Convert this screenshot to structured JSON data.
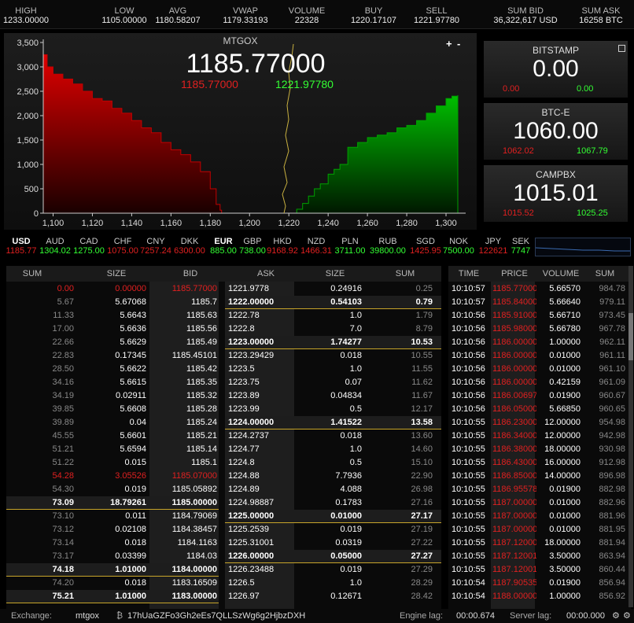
{
  "stats": [
    {
      "k": "HIGH",
      "v": "1233.00000"
    },
    {
      "k": "LOW",
      "v": "1105.00000"
    },
    {
      "k": "AVG",
      "v": "1180.58207"
    },
    {
      "k": "VWAP",
      "v": "1179.33193"
    },
    {
      "k": "VOLUME",
      "v": "22328"
    },
    {
      "k": "BUY",
      "v": "1220.17107"
    },
    {
      "k": "SELL",
      "v": "1221.97780"
    },
    {
      "k": "SUM BID",
      "v": "36,322,617 USD"
    },
    {
      "k": "SUM ASK",
      "v": "16258 BTC"
    }
  ],
  "chart": {
    "title": "MTGOX",
    "last": "1185.77000",
    "bid": "1185.77000",
    "ask": "1221.97780",
    "zoom_in": "+",
    "zoom_out": "-",
    "yticks": [
      "3,500",
      "3,000",
      "2,500",
      "2,000",
      "1,500",
      "1,000",
      "500",
      "0"
    ],
    "xticks": [
      "1,100",
      "1,120",
      "1,140",
      "1,160",
      "1,180",
      "1,200",
      "1,220",
      "1,240",
      "1,260",
      "1,280",
      "1,300"
    ]
  },
  "chart_data": {
    "type": "area",
    "xlim": [
      1095,
      1310
    ],
    "ylim": [
      0,
      3500
    ],
    "series": [
      {
        "color": "#c00000",
        "x": [
          1095,
          1097,
          1100,
          1105,
          1110,
          1115,
          1120,
          1125,
          1130,
          1135,
          1140,
          1145,
          1150,
          1155,
          1160,
          1165,
          1170,
          1175,
          1180,
          1183,
          1185,
          1185.77
        ],
        "y": [
          3250,
          3000,
          2850,
          2750,
          2650,
          2500,
          2350,
          2300,
          2150,
          2050,
          1900,
          1750,
          1650,
          1450,
          1300,
          1200,
          1050,
          850,
          500,
          180,
          60,
          0
        ]
      },
      {
        "color": "#00a000",
        "x": [
          1221.98,
          1224,
          1227,
          1230,
          1233,
          1236,
          1240,
          1243,
          1246,
          1250,
          1255,
          1260,
          1265,
          1270,
          1275,
          1280,
          1285,
          1290,
          1295,
          1300,
          1303,
          1306
        ],
        "y": [
          0,
          80,
          200,
          350,
          500,
          600,
          800,
          900,
          1000,
          1350,
          1450,
          1550,
          1600,
          1650,
          1750,
          1800,
          1900,
          2050,
          2200,
          2350,
          2400,
          2420
        ]
      }
    ]
  },
  "exchanges": [
    {
      "name": "BITSTAMP",
      "price": "0.00",
      "low": "0.00",
      "high": "0.00"
    },
    {
      "name": "BTC-E",
      "price": "1060.00",
      "low": "1062.02",
      "high": "1067.79"
    },
    {
      "name": "CAMPBX",
      "price": "1015.01",
      "low": "1015.52",
      "high": "1025.25"
    }
  ],
  "fiat": [
    {
      "k": "USD",
      "v": "1185.77",
      "c": "#e02020"
    },
    {
      "k": "AUD",
      "v": "1304.02",
      "c": "#33ff33"
    },
    {
      "k": "CAD",
      "v": "1275.00",
      "c": "#33ff33"
    },
    {
      "k": "CHF",
      "v": "1075.00",
      "c": "#e02020"
    },
    {
      "k": "CNY",
      "v": "7257.24",
      "c": "#e02020"
    },
    {
      "k": "DKK",
      "v": "6300.00",
      "c": "#e02020"
    },
    {
      "k": "EUR",
      "v": "885.00",
      "c": "#33ff33"
    },
    {
      "k": "GBP",
      "v": "738.00",
      "c": "#33ff33"
    },
    {
      "k": "HKD",
      "v": "9168.92",
      "c": "#e02020"
    },
    {
      "k": "NZD",
      "v": "1466.31",
      "c": "#e02020"
    },
    {
      "k": "PLN",
      "v": "3711.00",
      "c": "#33ff33"
    },
    {
      "k": "RUB",
      "v": "39800.00",
      "c": "#33ff33"
    },
    {
      "k": "SGD",
      "v": "1425.95",
      "c": "#e02020"
    },
    {
      "k": "NOK",
      "v": "7500.00",
      "c": "#33ff33"
    },
    {
      "k": "JPY",
      "v": "122621",
      "c": "#e02020"
    },
    {
      "k": "SEK",
      "v": "7747",
      "c": "#33ff33"
    }
  ],
  "book": {
    "headers": [
      "SUM",
      "SIZE",
      "BID",
      "ASK",
      "SIZE",
      "SUM"
    ],
    "rows": [
      [
        "0.00",
        "0.00000",
        "1185.77000",
        "1221.9778",
        "0.24916",
        "0.25",
        "red",
        "0",
        "0"
      ],
      [
        "5.67",
        "5.67068",
        "1185.7",
        "1222.00000",
        "0.54103",
        "0.79",
        "",
        "0",
        "1"
      ],
      [
        "11.33",
        "5.6643",
        "1185.63",
        "1222.78",
        "1.0",
        "1.79",
        "",
        "0",
        "0"
      ],
      [
        "17.00",
        "5.6636",
        "1185.56",
        "1222.8",
        "7.0",
        "8.79",
        "",
        "0",
        "0"
      ],
      [
        "22.66",
        "5.6629",
        "1185.49",
        "1223.00000",
        "1.74277",
        "10.53",
        "",
        "0",
        "1"
      ],
      [
        "22.83",
        "0.17345",
        "1185.45101",
        "1223.29429",
        "0.018",
        "10.55",
        "",
        "0",
        "0"
      ],
      [
        "28.50",
        "5.6622",
        "1185.42",
        "1223.5",
        "1.0",
        "11.55",
        "",
        "0",
        "0"
      ],
      [
        "34.16",
        "5.6615",
        "1185.35",
        "1223.75",
        "0.07",
        "11.62",
        "",
        "0",
        "0"
      ],
      [
        "34.19",
        "0.02911",
        "1185.32",
        "1223.89",
        "0.04834",
        "11.67",
        "",
        "0",
        "0"
      ],
      [
        "39.85",
        "5.6608",
        "1185.28",
        "1223.99",
        "0.5",
        "12.17",
        "",
        "0",
        "0"
      ],
      [
        "39.89",
        "0.04",
        "1185.24",
        "1224.00000",
        "1.41522",
        "13.58",
        "",
        "0",
        "1"
      ],
      [
        "45.55",
        "5.6601",
        "1185.21",
        "1224.2737",
        "0.018",
        "13.60",
        "",
        "0",
        "0"
      ],
      [
        "51.21",
        "5.6594",
        "1185.14",
        "1224.77",
        "1.0",
        "14.60",
        "",
        "0",
        "0"
      ],
      [
        "51.22",
        "0.015",
        "1185.1",
        "1224.8",
        "0.5",
        "15.10",
        "",
        "0",
        "0"
      ],
      [
        "54.28",
        "3.05526",
        "1185.07000",
        "1224.88",
        "7.7936",
        "22.90",
        "red",
        "0",
        "0"
      ],
      [
        "54.30",
        "0.019",
        "1185.05892",
        "1224.89",
        "4.088",
        "26.98",
        "",
        "0",
        "0"
      ],
      [
        "73.09",
        "18.79261",
        "1185.00000",
        "1224.98887",
        "0.1783",
        "27.16",
        "",
        "1",
        "0"
      ],
      [
        "73.10",
        "0.011",
        "1184.79069",
        "1225.00000",
        "0.01000",
        "27.17",
        "",
        "0",
        "1"
      ],
      [
        "73.12",
        "0.02108",
        "1184.38457",
        "1225.2539",
        "0.019",
        "27.19",
        "",
        "0",
        "0"
      ],
      [
        "73.14",
        "0.018",
        "1184.1163",
        "1225.31001",
        "0.0319",
        "27.22",
        "",
        "0",
        "0"
      ],
      [
        "73.17",
        "0.03399",
        "1184.03",
        "1226.00000",
        "0.05000",
        "27.27",
        "",
        "0",
        "1"
      ],
      [
        "74.18",
        "1.01000",
        "1184.00000",
        "1226.23488",
        "0.019",
        "27.29",
        "",
        "1",
        "0"
      ],
      [
        "74.20",
        "0.018",
        "1183.16509",
        "1226.5",
        "1.0",
        "28.29",
        "",
        "0",
        "0"
      ],
      [
        "75.21",
        "1.01000",
        "1183.00000",
        "1226.97",
        "0.12671",
        "28.42",
        "",
        "1",
        "0"
      ]
    ]
  },
  "trades": {
    "headers": [
      "TIME",
      "PRICE",
      "VOLUME",
      "SUM"
    ],
    "rows": [
      [
        "10:10:57",
        "1185.77000",
        "5.66570",
        "984.78"
      ],
      [
        "10:10:57",
        "1185.84000",
        "5.66640",
        "979.11"
      ],
      [
        "10:10:56",
        "1185.91000",
        "5.66710",
        "973.45"
      ],
      [
        "10:10:56",
        "1185.98000",
        "5.66780",
        "967.78"
      ],
      [
        "10:10:56",
        "1186.00000",
        "1.00000",
        "962.11"
      ],
      [
        "10:10:56",
        "1186.00000",
        "0.01000",
        "961.11"
      ],
      [
        "10:10:56",
        "1186.00000",
        "0.01000",
        "961.10"
      ],
      [
        "10:10:56",
        "1186.00000",
        "0.42159",
        "961.09"
      ],
      [
        "10:10:56",
        "1186.00697",
        "0.01900",
        "960.67"
      ],
      [
        "10:10:56",
        "1186.05000",
        "5.66850",
        "960.65"
      ],
      [
        "10:10:55",
        "1186.23000",
        "12.00000",
        "954.98"
      ],
      [
        "10:10:55",
        "1186.34000",
        "12.00000",
        "942.98"
      ],
      [
        "10:10:55",
        "1186.38000",
        "18.00000",
        "930.98"
      ],
      [
        "10:10:55",
        "1186.43000",
        "16.00000",
        "912.98"
      ],
      [
        "10:10:55",
        "1186.85000",
        "14.00000",
        "896.98"
      ],
      [
        "10:10:55",
        "1186.95578",
        "0.01900",
        "882.98"
      ],
      [
        "10:10:55",
        "1187.00000",
        "0.01000",
        "882.96"
      ],
      [
        "10:10:55",
        "1187.00000",
        "0.01000",
        "881.96"
      ],
      [
        "10:10:55",
        "1187.00000",
        "0.01000",
        "881.95"
      ],
      [
        "10:10:55",
        "1187.12000",
        "18.00000",
        "881.94"
      ],
      [
        "10:10:55",
        "1187.12001",
        "3.50000",
        "863.94"
      ],
      [
        "10:10:55",
        "1187.12001",
        "3.50000",
        "860.44"
      ],
      [
        "10:10:54",
        "1187.90535",
        "0.01900",
        "856.94"
      ],
      [
        "10:10:54",
        "1188.00000",
        "1.00000",
        "856.92"
      ]
    ]
  },
  "status": {
    "exchange_label": "Exchange:",
    "exchange": "mtgox",
    "address": "17hUaGZFo3Gh2eEs7QLLSzWg6g2HjbzDXH",
    "engine_label": "Engine lag:",
    "engine": "00:00.674",
    "server_label": "Server lag:",
    "server": "00:00.000"
  }
}
